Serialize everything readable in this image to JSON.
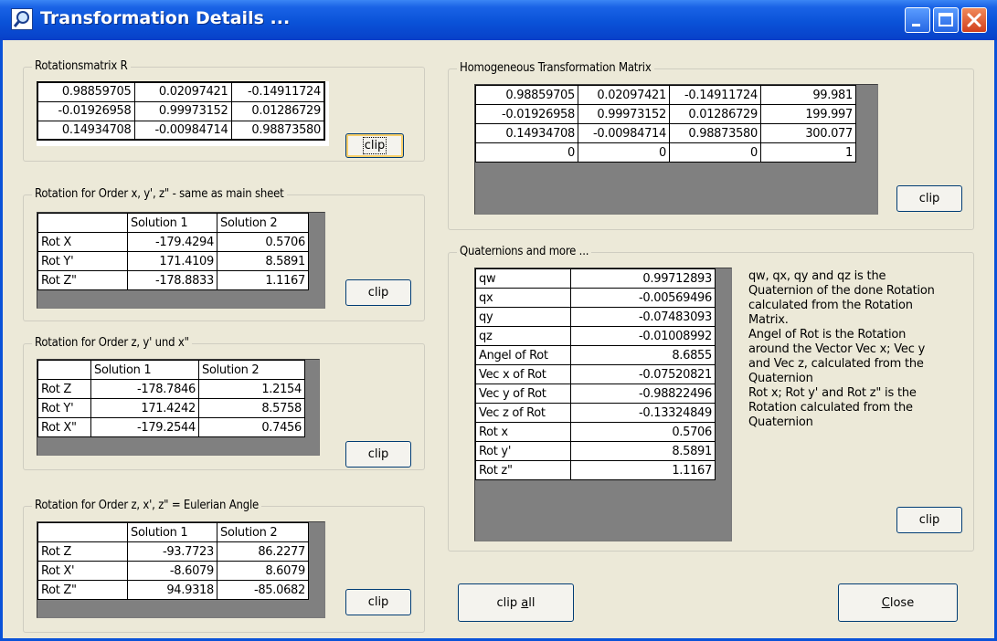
{
  "window": {
    "title": "Transformation Details ...",
    "colors": {
      "titlebar": "#0a52d8",
      "face": "#ece9d8",
      "close_button": "#d2401e",
      "border": "#0a52d8"
    }
  },
  "rotation_matrix": {
    "label": "Rotationsmatrix R",
    "rows": [
      [
        "0.98859705",
        "0.02097421",
        "-0.14911724"
      ],
      [
        "-0.01926958",
        "0.99973152",
        "0.01286729"
      ],
      [
        "0.14934708",
        "-0.00984714",
        "0.98873580"
      ]
    ],
    "clip_label": "clip"
  },
  "order_xyz": {
    "label": "Rotation for Order x, y', z\" - same as main sheet",
    "headers": [
      "",
      "Solution 1",
      "Solution 2"
    ],
    "rows": [
      [
        "Rot X",
        "-179.4294",
        "0.5706"
      ],
      [
        "Rot Y'",
        "171.4109",
        "8.5891"
      ],
      [
        "Rot Z\"",
        "-178.8833",
        "1.1167"
      ]
    ],
    "clip_label": "clip"
  },
  "order_zyx": {
    "label": "Rotation for Order z, y' und x\"",
    "headers": [
      "",
      "Solution 1",
      "Solution 2"
    ],
    "rows": [
      [
        "Rot Z",
        "-178.7846",
        "1.2154"
      ],
      [
        "Rot Y'",
        "171.4242",
        "8.5758"
      ],
      [
        "Rot X\"",
        "-179.2544",
        "0.7456"
      ]
    ],
    "clip_label": "clip"
  },
  "order_zxz": {
    "label": "Rotation for Order z, x', z\" = Eulerian Angle",
    "headers": [
      "",
      "Solution 1",
      "Solution 2"
    ],
    "rows": [
      [
        "Rot Z",
        "-93.7723",
        "86.2277"
      ],
      [
        "Rot X'",
        "-8.6079",
        "8.6079"
      ],
      [
        "Rot Z\"",
        "94.9318",
        "-85.0682"
      ]
    ],
    "clip_label": "clip"
  },
  "homogeneous": {
    "label": "Homogeneous Transformation Matrix",
    "rows": [
      [
        "0.98859705",
        "0.02097421",
        "-0.14911724",
        "99.981"
      ],
      [
        "-0.01926958",
        "0.99973152",
        "0.01286729",
        "199.997"
      ],
      [
        "0.14934708",
        "-0.00984714",
        "0.98873580",
        "300.077"
      ],
      [
        "0",
        "0",
        "0",
        "1"
      ]
    ],
    "clip_label": "clip"
  },
  "quaternions": {
    "label": "Quaternions and more ...",
    "rows": [
      [
        "qw",
        "0.99712893"
      ],
      [
        "qx",
        "-0.00569496"
      ],
      [
        "qy",
        "-0.07483093"
      ],
      [
        "qz",
        "-0.01008992"
      ],
      [
        "Angel of Rot",
        "8.6855"
      ],
      [
        "Vec x of Rot",
        "-0.07520821"
      ],
      [
        "Vec y of Rot",
        "-0.98822496"
      ],
      [
        "Vec z of Rot",
        "-0.13324849"
      ],
      [
        "Rot x",
        "0.5706"
      ],
      [
        "Rot y'",
        "8.5891"
      ],
      [
        "Rot z\"",
        "1.1167"
      ]
    ],
    "description": [
      "qw, qx, qy and qz is the",
      "Quaternion of the done Rotation",
      "calculated from the Rotation",
      "Matrix.",
      "Angel of Rot is the Rotation",
      "around the Vector Vec x; Vec y",
      "and Vec z, calculated from the",
      "Quaternion",
      "Rot x; Rot y' and Rot z\" is the",
      "Rotation calculated from the",
      "Quaternion"
    ],
    "clip_label": "clip"
  },
  "footer": {
    "clip_all": {
      "pre": "clip ",
      "mnemonic": "a",
      "post": "ll"
    },
    "close": {
      "pre": "",
      "mnemonic": "C",
      "post": "lose"
    }
  }
}
